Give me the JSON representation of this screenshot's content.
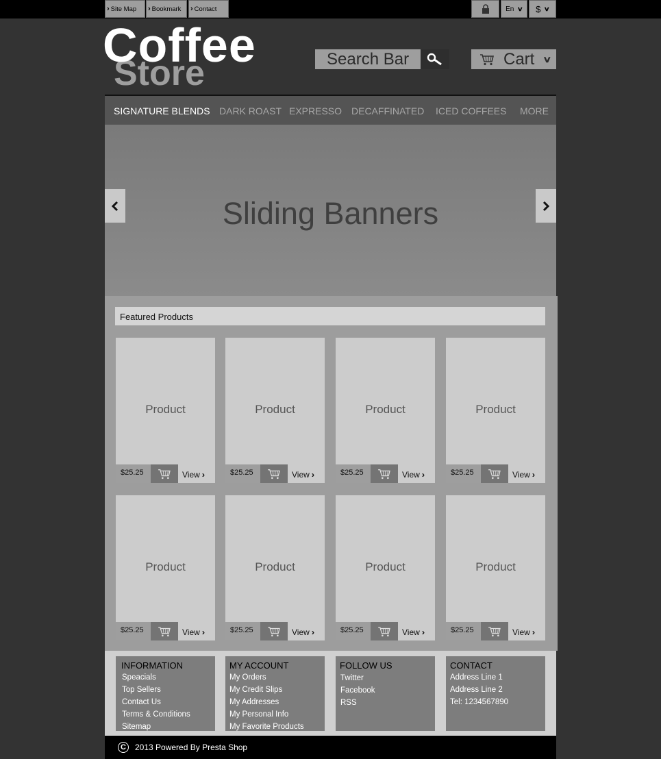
{
  "topbar": {
    "links": [
      {
        "label": "Site Map"
      },
      {
        "label": "Bookmark"
      },
      {
        "label": "Contact"
      }
    ],
    "language": "En",
    "currency": "$"
  },
  "logo": {
    "line1": "Coffee",
    "line2": "Store"
  },
  "search": {
    "label": "Search Bar"
  },
  "cart": {
    "label": "Cart"
  },
  "nav": {
    "items": [
      {
        "label": "SIGNATURE BLENDS"
      },
      {
        "label": "DARK ROAST"
      },
      {
        "label": "EXPRESSO"
      },
      {
        "label": "DECAFFINATED"
      },
      {
        "label": "ICED COFFEES"
      },
      {
        "label": "MORE"
      }
    ]
  },
  "banner": {
    "title": "Sliding Banners"
  },
  "featured": {
    "title": "Featured Products",
    "products": [
      {
        "name": "Product",
        "price": "$25.25",
        "view": "View"
      },
      {
        "name": "Product",
        "price": "$25.25",
        "view": "View"
      },
      {
        "name": "Product",
        "price": "$25.25",
        "view": "View"
      },
      {
        "name": "Product",
        "price": "$25.25",
        "view": "View"
      },
      {
        "name": "Product",
        "price": "$25.25",
        "view": "View"
      },
      {
        "name": "Product",
        "price": "$25.25",
        "view": "View"
      },
      {
        "name": "Product",
        "price": "$25.25",
        "view": "View"
      },
      {
        "name": "Product",
        "price": "$25.25",
        "view": "View"
      }
    ]
  },
  "footer": {
    "columns": [
      {
        "title": "INFORMATION",
        "items": [
          "Speacials",
          "Top Sellers",
          "Contact Us",
          "Terms & Conditions",
          "Sitemap"
        ]
      },
      {
        "title": "MY ACCOUNT",
        "items": [
          "My Orders",
          "My Credit Slips",
          "My Addresses",
          "My Personal Info",
          "My Favorite Products"
        ]
      },
      {
        "title": "FOLLOW US",
        "items": [
          "Twitter",
          "Facebook",
          "RSS"
        ]
      },
      {
        "title": "CONTACT",
        "items": [
          "Address Line 1",
          "Address Line 2",
          "Tel: 1234567890"
        ]
      }
    ]
  },
  "copyright": {
    "text": "2013 Powered By Presta Shop",
    "symbol": "C"
  }
}
